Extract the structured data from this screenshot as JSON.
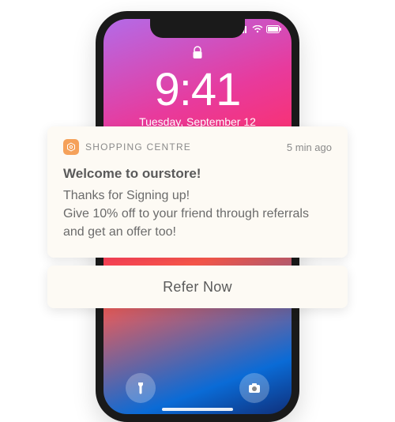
{
  "lockscreen": {
    "time": "9:41",
    "date": "Tuesday, September 12"
  },
  "notification": {
    "app_name": "SHOPPING CENTRE",
    "time_ago": "5 min ago",
    "title": "Welcome to ourstore!",
    "body": "Thanks for Signing up!\nGive 10% off to your friend through referrals and get an offer too!"
  },
  "action": {
    "label": "Refer Now"
  },
  "colors": {
    "card_bg": "#fdfaf4",
    "app_icon_bg": "#f5a15a"
  }
}
